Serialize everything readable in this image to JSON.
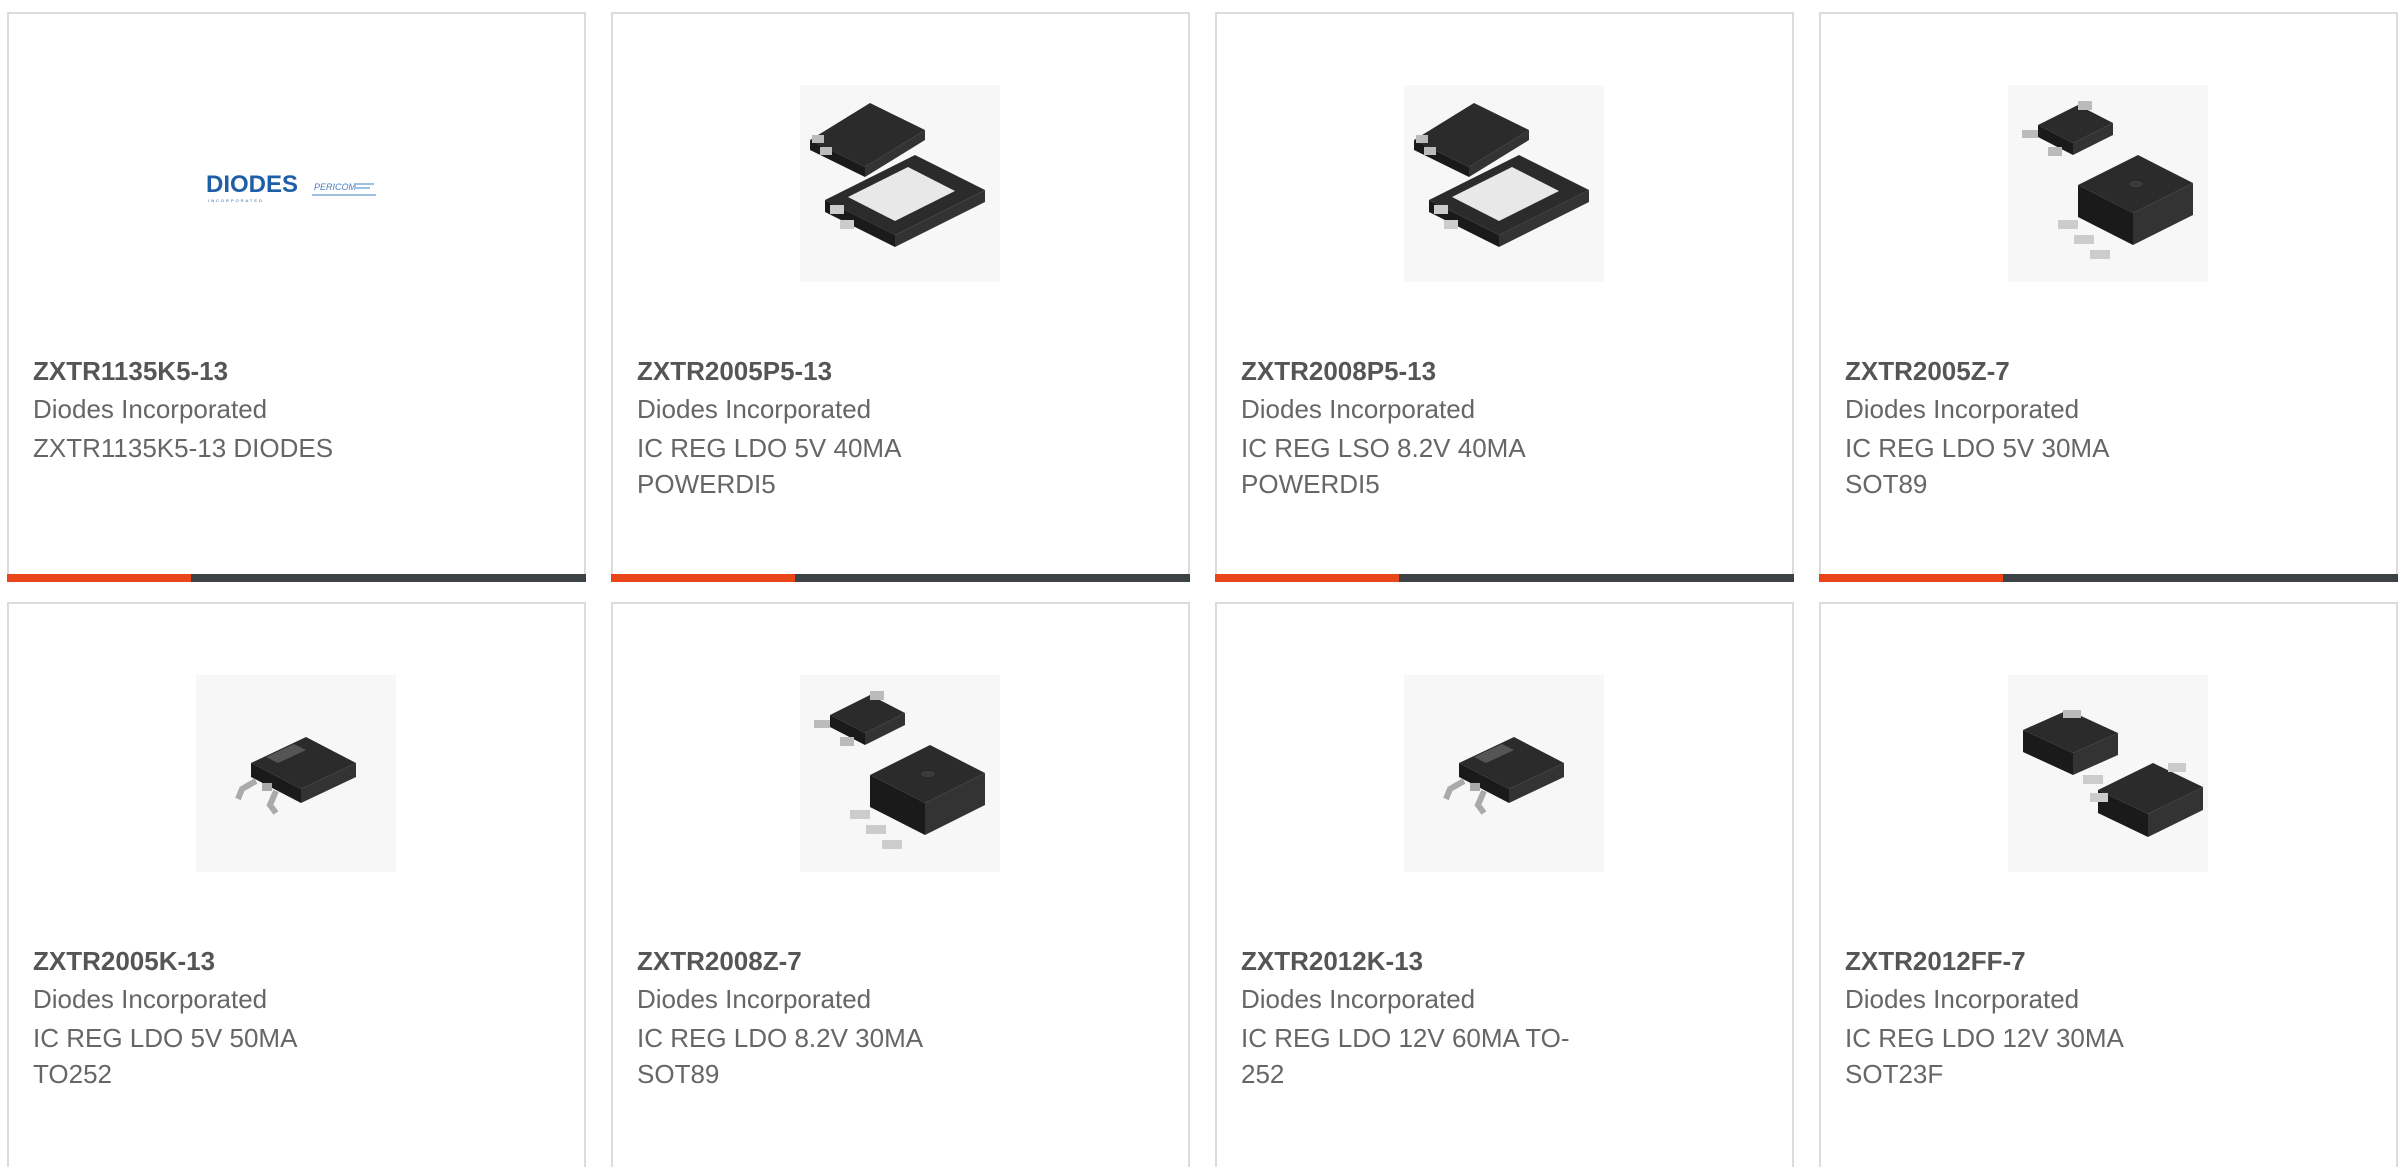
{
  "colors": {
    "accent_orange": "#e8461a",
    "accent_dark": "#3d4244",
    "border": "#dcdcdc",
    "part_number_text": "#555555",
    "body_text": "#666666",
    "logo_blue": "#1f5fa8",
    "package_black": "#2b2b2b"
  },
  "products": [
    {
      "part_number": "ZXTR1135K5-13",
      "manufacturer": "Diodes Incorporated",
      "description": "ZXTR1135K5-13 DIODES",
      "image": "diodes-logo",
      "logo": {
        "brand": "DIODES",
        "sub": "INCORPORATED",
        "brand2": "PERICOM"
      }
    },
    {
      "part_number": "ZXTR2005P5-13",
      "manufacturer": "Diodes Incorporated",
      "description": "IC REG LDO 5V 40MA POWERDI5",
      "image": "powerdi5-package-icon"
    },
    {
      "part_number": "ZXTR2008P5-13",
      "manufacturer": "Diodes Incorporated",
      "description": "IC REG LSO 8.2V 40MA POWERDI5",
      "image": "powerdi5-package-icon"
    },
    {
      "part_number": "ZXTR2005Z-7",
      "manufacturer": "Diodes Incorporated",
      "description": "IC REG LDO 5V 30MA SOT89",
      "image": "sot89-package-icon"
    },
    {
      "part_number": "ZXTR2005K-13",
      "manufacturer": "Diodes Incorporated",
      "description": "IC REG LDO 5V 50MA TO252",
      "image": "to252-package-icon"
    },
    {
      "part_number": "ZXTR2008Z-7",
      "manufacturer": "Diodes Incorporated",
      "description": "IC REG LDO 8.2V 30MA SOT89",
      "image": "sot89-package-icon"
    },
    {
      "part_number": "ZXTR2012K-13",
      "manufacturer": "Diodes Incorporated",
      "description": "IC REG LDO 12V 60MA TO-252",
      "image": "to252-package-icon"
    },
    {
      "part_number": "ZXTR2012FF-7",
      "manufacturer": "Diodes Incorporated",
      "description": "IC REG LDO 12V 30MA SOT23F",
      "image": "sot23f-package-icon"
    }
  ]
}
